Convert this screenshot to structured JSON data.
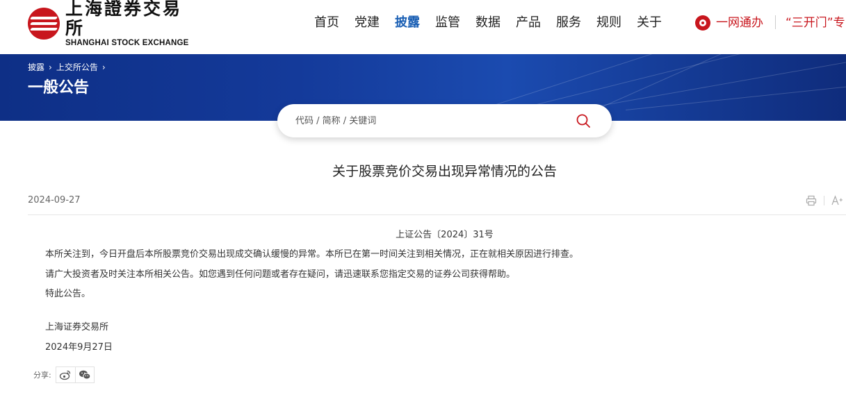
{
  "header": {
    "logo_cn": "上海證券交易所",
    "logo_en": "SHANGHAI STOCK EXCHANGE",
    "nav": [
      {
        "label": "首页"
      },
      {
        "label": "党建"
      },
      {
        "label": "披露",
        "active": true
      },
      {
        "label": "监管"
      },
      {
        "label": "数据"
      },
      {
        "label": "产品"
      },
      {
        "label": "服务"
      },
      {
        "label": "规则"
      },
      {
        "label": "关于"
      }
    ],
    "onenet_label": "一网通办",
    "sankai_label": "“三开门”专"
  },
  "banner": {
    "breadcrumbs": [
      "披露",
      "上交所公告"
    ],
    "page_title": "一般公告"
  },
  "search": {
    "placeholder": "代码 / 简称 / 关键词"
  },
  "article": {
    "title": "关于股票竞价交易出现异常情况的公告",
    "date": "2024-09-27",
    "doc_number": "上证公告〔2024〕31号",
    "paragraphs": [
      "本所关注到，今日开盘后本所股票竞价交易出现成交确认缓慢的异常。本所已在第一时间关注到相关情况，正在就相关原因进行排查。",
      "请广大投资者及时关注本所相关公告。如您遇到任何问题或者存在疑问，请迅速联系您指定交易的证券公司获得帮助。",
      "特此公告。"
    ],
    "signature": "上海证券交易所",
    "signature_date": "2024年9月27日"
  },
  "share": {
    "label": "分享:",
    "icons": [
      "weibo-icon",
      "wechat-icon"
    ]
  },
  "colors": {
    "brand_red": "#c8161d",
    "nav_active": "#1a5fb4",
    "banner_blue": "#143a9a"
  }
}
